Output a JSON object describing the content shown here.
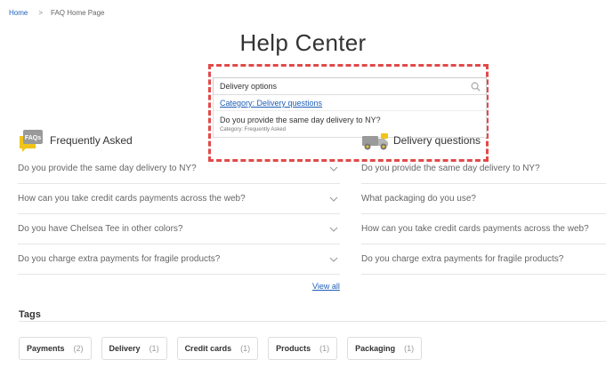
{
  "breadcrumb": {
    "home": "Home",
    "separator": ">",
    "current": "FAQ Home Page"
  },
  "page_title": "Help Center",
  "search": {
    "value": "Delivery options",
    "suggestion_category": "Category: Delivery questions",
    "suggestion_question": "Do you provide the same day delivery to NY?",
    "suggestion_sub": "Category: Frequently Asked"
  },
  "frequently_asked": {
    "title": "Frequently Asked",
    "badge": "FAQs",
    "questions": [
      "Do you provide the same day delivery to NY?",
      "How can you take credit cards payments across the web?",
      "Do you have Chelsea Tee in other colors?",
      "Do you charge extra payments for fragile products?"
    ],
    "view_all": "View all"
  },
  "delivery_questions": {
    "title": "Delivery questions",
    "questions": [
      "Do you provide the same day delivery to NY?",
      "What packaging do you use?",
      "How can you take credit cards payments across the web?",
      "Do you charge extra payments for fragile products?"
    ]
  },
  "tags": {
    "title": "Tags",
    "items": [
      {
        "label": "Payments",
        "count": "(2)"
      },
      {
        "label": "Delivery",
        "count": "(1)"
      },
      {
        "label": "Credit cards",
        "count": "(1)"
      },
      {
        "label": "Products",
        "count": "(1)"
      },
      {
        "label": "Packaging",
        "count": "(1)"
      }
    ]
  },
  "colors": {
    "link": "#1f5fb6",
    "highlight": "#e14a4a",
    "badge": "#f0c419"
  }
}
